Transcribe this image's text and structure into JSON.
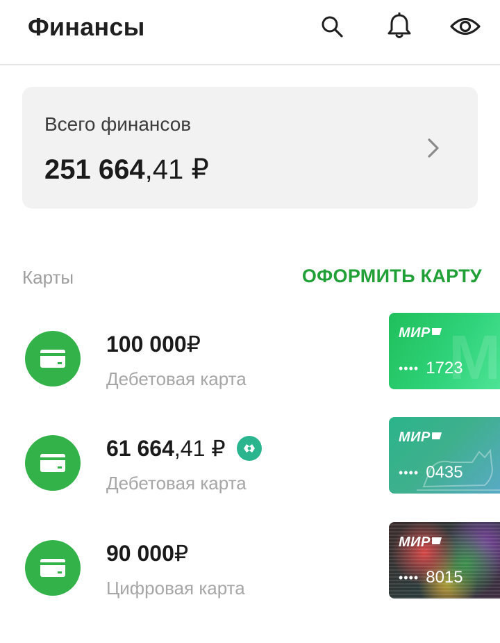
{
  "header": {
    "title": "Финансы",
    "icons": [
      "search-icon",
      "bell-icon",
      "eye-icon"
    ]
  },
  "total": {
    "label": "Всего финансов",
    "amount_int": "251 664",
    "amount_frac": ",41 ₽"
  },
  "cards_section": {
    "title": "Карты",
    "action_label": "ОФОРМИТЬ КАРТУ"
  },
  "cards": [
    {
      "amount_int": "100 000",
      "amount_frac": " ₽",
      "type": "Дебетовая карта",
      "brand": "МИР",
      "dots": "••••",
      "last4": "1723",
      "has_loyalty_badge": false
    },
    {
      "amount_int": "61 664",
      "amount_frac": ",41 ₽",
      "type": "Дебетовая карта",
      "brand": "МИР",
      "dots": "••••",
      "last4": "0435",
      "has_loyalty_badge": true
    },
    {
      "amount_int": "90 000",
      "amount_frac": " ₽",
      "type": "Цифровая карта",
      "brand": "МИР",
      "dots": "••••",
      "last4": "8015",
      "has_loyalty_badge": false
    }
  ],
  "colors": {
    "accent_green": "#21a038",
    "icon_circle": "#34b24a",
    "loyalty_badge": "#2bb58e",
    "muted_text": "#a6a6a6",
    "card_bg": "#f2f2f2"
  }
}
